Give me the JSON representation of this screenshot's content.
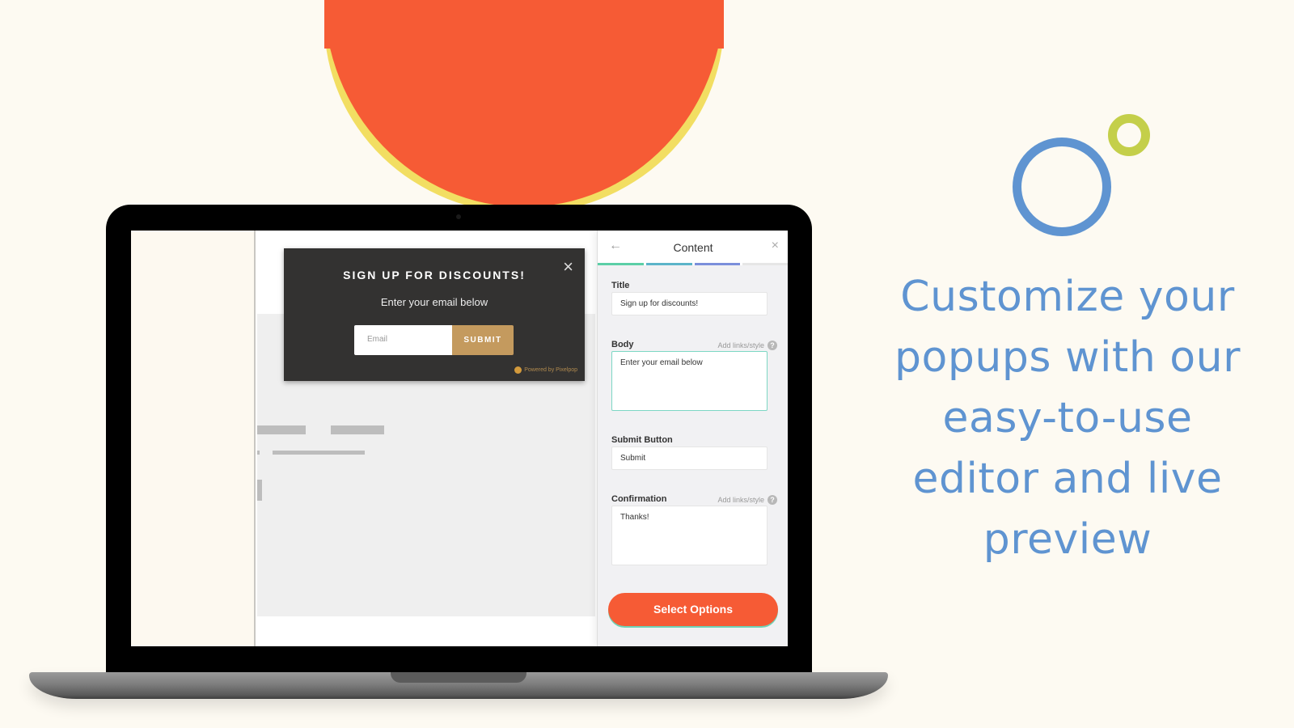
{
  "colors": {
    "background": "#fdfaf2",
    "accent_orange": "#f65b35",
    "accent_yellow": "#f2de62",
    "accent_blue": "#5f94d1",
    "accent_green": "#c4cf4a",
    "popup_bg": "#333231",
    "popup_submit": "#c49a5e",
    "focus_teal": "#7dd7c4"
  },
  "popup": {
    "title": "SIGN UP FOR DISCOUNTS!",
    "body": "Enter your email below",
    "email_placeholder": "Email",
    "submit_label": "SUBMIT",
    "close_icon": "×",
    "powered_by": "Powered by Pixelpop"
  },
  "editor": {
    "back_icon": "←",
    "title": "Content",
    "close_icon": "×",
    "progress_steps": [
      {
        "color": "#5ccfa6",
        "complete": true
      },
      {
        "color": "#5cb4c9",
        "complete": true
      },
      {
        "color": "#7b8fdb",
        "complete": true
      },
      {
        "color": "#e6e6e6",
        "complete": false
      }
    ],
    "fields": {
      "title": {
        "label": "Title",
        "value": "Sign up for discounts!"
      },
      "body": {
        "label": "Body",
        "aux": "Add links/style",
        "value": "Enter your email below"
      },
      "submit_button": {
        "label": "Submit Button",
        "value": "Submit"
      },
      "confirmation": {
        "label": "Confirmation",
        "aux": "Add links/style",
        "value": "Thanks!"
      }
    },
    "help_icon": "?",
    "select_options_label": "Select Options"
  },
  "tagline": "Customize your popups with our easy-to-use editor and live preview"
}
